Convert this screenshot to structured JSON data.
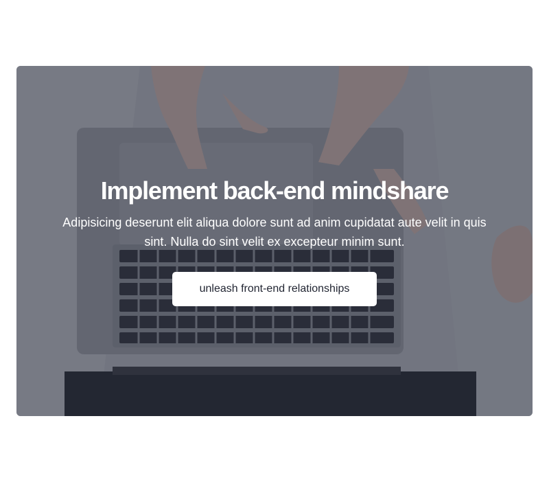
{
  "hero": {
    "title": "Implement back-end mindshare",
    "description": "Adipisicing deserunt elit aliqua dolore sunt ad anim cupidatat aute velit in quis sint. Nulla do sint velit ex excepteur minim sunt.",
    "cta_label": "unleash front-end relationships",
    "background_image": "laptop-keyboard-hands-photo",
    "overlay_color": "#2a2e3c"
  },
  "colors": {
    "page_background": "#ffffff",
    "button_background": "#ffffff",
    "button_text": "#1f2330",
    "hero_text": "#ffffff"
  }
}
